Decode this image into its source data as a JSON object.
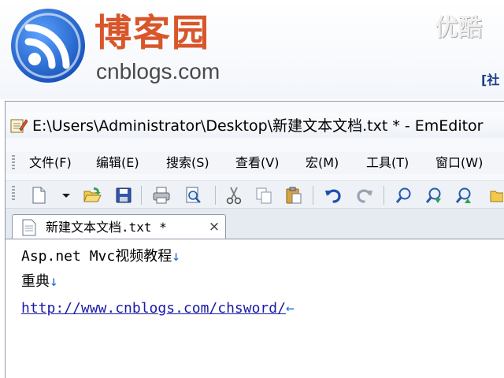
{
  "banner": {
    "site_name": "博客园",
    "site_domain": "cnblogs.com",
    "nav_fragment": "[社",
    "watermark": "优酷",
    "logo_icon": "rss-feed-icon"
  },
  "window": {
    "title": "E:\\Users\\Administrator\\Desktop\\新建文本文档.txt * - EmEditor",
    "icon": "notepad-pencil-icon"
  },
  "menu": {
    "items": [
      {
        "label": "文件(F)"
      },
      {
        "label": "编辑(E)"
      },
      {
        "label": "搜索(S)"
      },
      {
        "label": "查看(V)"
      },
      {
        "label": "宏(M)"
      },
      {
        "label": "工具(T)"
      },
      {
        "label": "窗口(W)"
      }
    ]
  },
  "toolbar": {
    "buttons": [
      "new-file-icon",
      "dropdown-arrow-icon",
      "open-folder-icon",
      "save-icon",
      "print-icon",
      "print-preview-icon",
      "cut-icon",
      "copy-icon",
      "paste-icon",
      "undo-icon",
      "redo-icon",
      "find-icon",
      "find-next-icon",
      "find-previous-icon",
      "folder-icon"
    ]
  },
  "tab": {
    "label": "新建文本文档.txt *",
    "close_glyph": "×"
  },
  "editor": {
    "lines": [
      {
        "text": "Asp.net Mvc视频教程",
        "end_mark": "↓"
      },
      {
        "text": "重典",
        "end_mark": "↓"
      },
      {
        "text": "http://www.cnblogs.com/chsword/",
        "end_mark": "←"
      }
    ]
  },
  "colors": {
    "brand_orange": "#d8562a",
    "rss_blue": "#1f63c6",
    "link_blue": "#1a1aa6",
    "newline_mark": "#1f6ed4"
  }
}
